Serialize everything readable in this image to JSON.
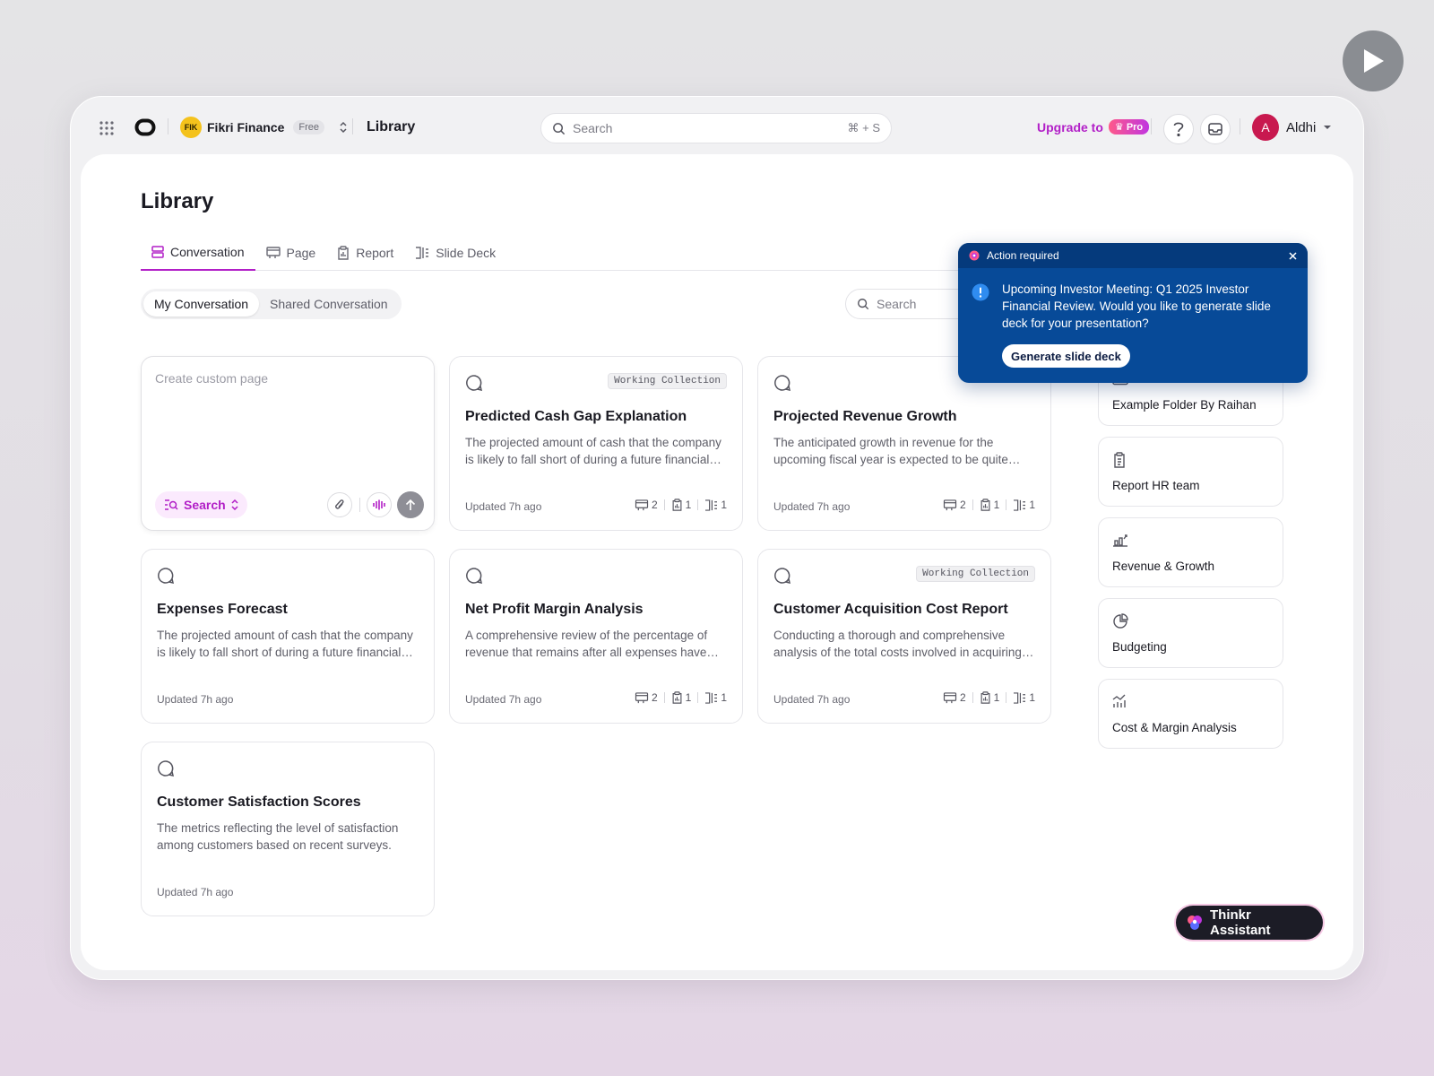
{
  "topbar": {
    "workspace": {
      "initials": "FIK",
      "name": "Fikri Finance",
      "plan": "Free"
    },
    "breadcrumb": "Library",
    "search": {
      "placeholder": "Search",
      "shortcut": "⌘ + S"
    },
    "upgrade": {
      "label": "Upgrade to",
      "badge": "Pro"
    },
    "user": {
      "initial": "A",
      "name": "Aldhi"
    }
  },
  "page": {
    "title": "Library",
    "tabs": [
      {
        "label": "Conversation",
        "active": true
      },
      {
        "label": "Page"
      },
      {
        "label": "Report"
      },
      {
        "label": "Slide Deck"
      }
    ],
    "segments": [
      "My Conversation",
      "Shared Conversation"
    ],
    "search_placeholder": "Search"
  },
  "create_card": {
    "placeholder": "Create custom page",
    "mode_label": "Search"
  },
  "cards": [
    {
      "title": "Predicted Cash Gap Explanation",
      "tag": "Working Collection",
      "desc": "The projected amount of cash that the company is likely to fall short of during a future financial period.",
      "updated": "Updated 7h ago",
      "stats": [
        "2",
        "1",
        "1"
      ]
    },
    {
      "title": "Projected Revenue Growth",
      "tag": "",
      "desc": "The anticipated growth in revenue for the upcoming fiscal year is expected to be quite substantial.",
      "updated": "Updated 7h ago",
      "stats": [
        "2",
        "1",
        "1"
      ]
    },
    {
      "title": "Expenses Forecast",
      "tag": "",
      "desc": "The projected amount of cash that the company is likely to fall short of during a future financial period.",
      "updated": "Updated 7h ago",
      "stats": []
    },
    {
      "title": "Net Profit Margin Analysis",
      "tag": "",
      "desc": "A comprehensive review of the percentage of revenue that remains after all expenses have been deducted.",
      "updated": "Updated 7h ago",
      "stats": [
        "2",
        "1",
        "1"
      ]
    },
    {
      "title": "Customer Acquisition Cost Report",
      "tag": "Working Collection",
      "desc": "Conducting a thorough and comprehensive analysis of the total costs involved in acquiring new customers.",
      "updated": "Updated 7h ago",
      "stats": [
        "2",
        "1",
        "1"
      ]
    },
    {
      "title": "Customer Satisfaction Scores",
      "tag": "",
      "desc": "The metrics reflecting the level of satisfaction among customers based on recent surveys.",
      "updated": "Updated 7h ago",
      "stats": []
    }
  ],
  "folders": [
    {
      "label": "Example Folder By Raihan",
      "icon": "folder-icon"
    },
    {
      "label": "Report HR team",
      "icon": "clipboard-icon"
    },
    {
      "label": "Revenue & Growth",
      "icon": "bar-chart-icon"
    },
    {
      "label": "Budgeting",
      "icon": "pie-chart-icon"
    },
    {
      "label": "Cost & Margin Analysis",
      "icon": "trend-chart-icon"
    }
  ],
  "popup": {
    "header": "Action required",
    "message": "Upcoming Investor Meeting: Q1 2025 Investor Financial Review. Would you like to generate slide deck for your presentation?",
    "button": "Generate slide deck"
  },
  "assistant": {
    "label": "Thinkr Assistant"
  },
  "colors": {
    "accent": "#b21fc7",
    "popup_bg": "#074a98",
    "user_avatar": "#c8194f"
  }
}
